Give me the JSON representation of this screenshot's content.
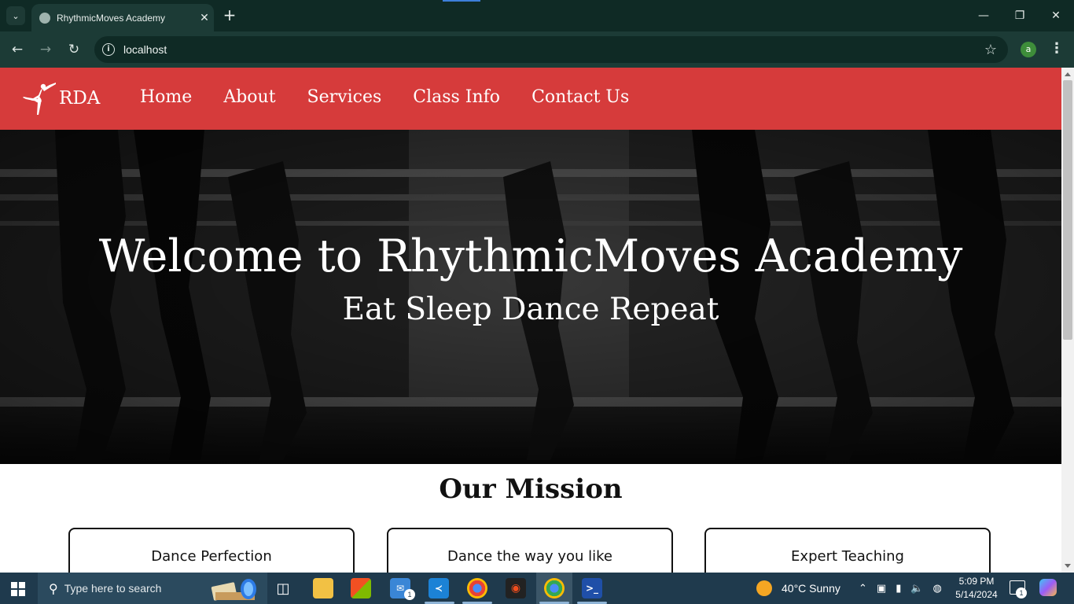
{
  "browser": {
    "tab_title": "RhythmicMoves Academy",
    "url": "localhost",
    "profile_initial": "a",
    "icons": {
      "tab_search": "chevron-down-icon",
      "favicon": "globe-icon",
      "close": "close-icon",
      "new_tab": "plus-icon",
      "back": "arrow-left-icon",
      "forward": "arrow-right-icon",
      "reload": "reload-icon",
      "site_info": "info-icon",
      "bookmark": "star-icon",
      "menu": "kebab-menu-icon"
    }
  },
  "site": {
    "brand": "RDA",
    "nav": [
      "Home",
      "About",
      "Services",
      "Class Info",
      "Contact Us"
    ],
    "hero_title": "Welcome to RhythmicMoves Academy",
    "hero_subtitle": "Eat Sleep Dance Repeat",
    "mission_title": "Our Mission",
    "cards": [
      "Dance Perfection",
      "Dance the way you like",
      "Expert Teaching"
    ],
    "colors": {
      "nav_bg": "#d63b3b",
      "hero_overlay": "#1a1a1a"
    }
  },
  "taskbar": {
    "search_placeholder": "Type here to search",
    "weather": "40°C  Sunny",
    "time": "5:09 PM",
    "date": "5/14/2024",
    "mail_badge": "1",
    "notification_badge": "1",
    "pinned": [
      "task-view-icon",
      "file-explorer-icon",
      "microsoft-store-icon",
      "mail-icon",
      "vscode-icon",
      "chrome-profile-icon",
      "figma-icon",
      "chrome-icon",
      "powershell-icon"
    ]
  }
}
